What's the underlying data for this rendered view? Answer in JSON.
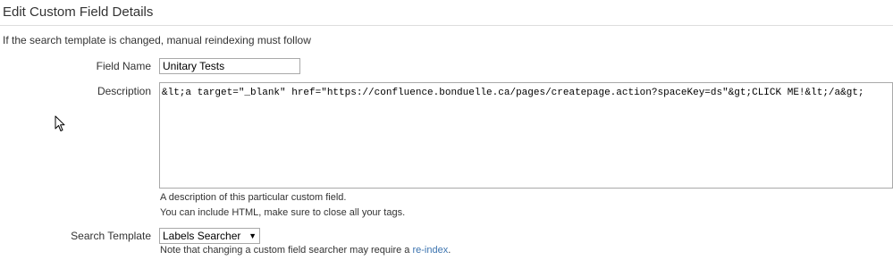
{
  "page": {
    "title": "Edit Custom Field Details",
    "reindex_warning": "If the search template is changed, manual reindexing must follow"
  },
  "form": {
    "field_name": {
      "label": "Field Name",
      "value": "Unitary Tests"
    },
    "description": {
      "label": "Description",
      "value": "&lt;a target=\"_blank\" href=\"https://confluence.bonduelle.ca/pages/createpage.action?spaceKey=ds\"&gt;CLICK ME!&lt;/a&gt;",
      "help_line1": "A description of this particular custom field.",
      "help_line2": "You can include HTML, make sure to close all your tags."
    },
    "search_template": {
      "label": "Search Template",
      "selected": "Labels Searcher",
      "note_prefix": "Note that changing a custom field searcher may require a ",
      "note_link": "re-index",
      "note_suffix": "."
    }
  },
  "icons": {
    "cursor": "mouse-pointer-icon",
    "dropdown": "triangle-down-icon"
  },
  "colors": {
    "link": "#3b73af",
    "divider": "#dddddd",
    "border": "#a9a9a9"
  }
}
